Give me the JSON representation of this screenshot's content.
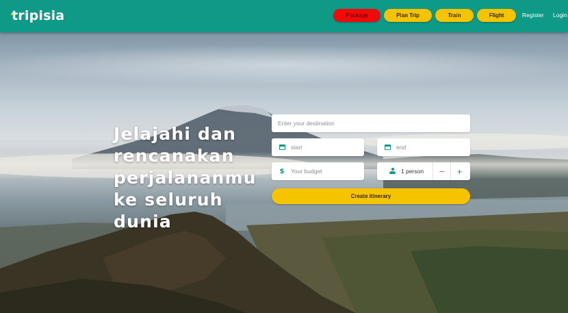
{
  "brand": {
    "name": "tripisia"
  },
  "nav": {
    "package": "Package",
    "plan_trip": "Plan Trip",
    "train": "Train",
    "flight": "Flight",
    "register": "Register",
    "login": "Login"
  },
  "hero": {
    "headline_lines": [
      "Jelajahi dan",
      "rencanakan",
      "perjalananmu",
      "ke seluruh",
      "dunia"
    ]
  },
  "form": {
    "destination_placeholder": "Enter your destination",
    "start_placeholder": "start",
    "end_placeholder": "end",
    "budget_placeholder": "Your budget",
    "person_count": "1 person",
    "minus": "−",
    "plus": "+",
    "submit": "Create itinerary"
  },
  "colors": {
    "primary": "#0f9a88",
    "accent": "#f6c300",
    "package_red": "#f20a0a"
  },
  "icons": {
    "date": "calendar-icon",
    "budget": "dollar-icon",
    "person": "person-icon"
  }
}
